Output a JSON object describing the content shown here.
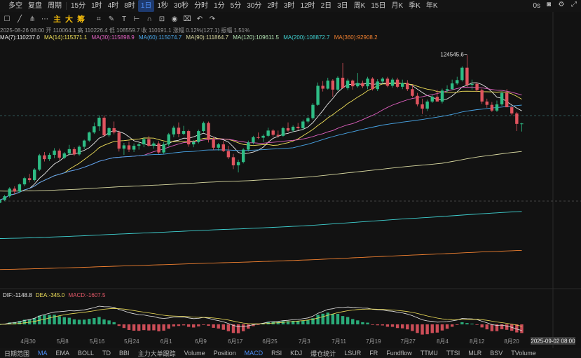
{
  "toolbar": {
    "items": [
      "多空",
      "复盘",
      "周期",
      "15分",
      "1时",
      "4时",
      "8时",
      "1日",
      "1秒",
      "30秒",
      "分时",
      "1分",
      "5分",
      "30分",
      "2时",
      "3时",
      "12时",
      "2日",
      "3日",
      "周K",
      "15日",
      "月K",
      "季K",
      "年K"
    ],
    "active_index": 7,
    "right": [
      "0s"
    ]
  },
  "toolbar2": {
    "zdc": [
      "主",
      "大",
      "筹"
    ]
  },
  "info1": "2025-08-26 08:00  开 110064.1  高 110226.4  低 108559.7  收 110191.1  涨幅 0.12%(127.1)  振幅 1.51%",
  "info2": [
    {
      "text": "MA(7):110237.0",
      "color": "#e8e8e8"
    },
    {
      "text": "MA(14):115371.1",
      "color": "#f0e05a"
    },
    {
      "text": "MA(30):115898.9",
      "color": "#e060c0"
    },
    {
      "text": "MA(60):115074.7",
      "color": "#49a6e8"
    },
    {
      "text": "MA(90):111864.7",
      "color": "#d8d8a0"
    },
    {
      "text": "MA(120):109611.5",
      "color": "#b0e0b0"
    },
    {
      "text": "MA(200):108872.7",
      "color": "#3fd0d0"
    },
    {
      "text": "MA(360):92908.2",
      "color": "#f08030"
    }
  ],
  "macd_legend": [
    {
      "text": "DIF:-1148.8",
      "color": "#e8e8e8"
    },
    {
      "text": "DEA:-345.0",
      "color": "#f0e05a"
    },
    {
      "text": "MACD:-1607.5",
      "color": "#e85a6a"
    }
  ],
  "high_label": "124545.6",
  "crosshair_date": "2025-09-02 08:00",
  "colors": {
    "up": "#2ebd85",
    "down": "#e0545f",
    "bg": "#121212"
  },
  "chart_data": {
    "type": "candlestick",
    "x_ticks": [
      "4月30",
      "5月8",
      "5月16",
      "5月24",
      "6月1",
      "6月9",
      "6月17",
      "6月25",
      "7月3",
      "7月11",
      "7月19",
      "7月27",
      "8月4",
      "8月12",
      "8月20"
    ],
    "candles": [
      [
        93500,
        94300,
        92900,
        94100
      ],
      [
        94100,
        95200,
        93900,
        94900
      ],
      [
        94900,
        96800,
        94600,
        96500
      ],
      [
        96500,
        97000,
        95300,
        95900
      ],
      [
        95900,
        97600,
        95600,
        97400
      ],
      [
        97400,
        99000,
        97000,
        98700
      ],
      [
        98700,
        99600,
        97800,
        98300
      ],
      [
        98300,
        100800,
        98000,
        100500
      ],
      [
        100500,
        103800,
        100200,
        103500
      ],
      [
        103500,
        104200,
        102200,
        102700
      ],
      [
        102700,
        104000,
        102300,
        103600
      ],
      [
        103600,
        105000,
        102900,
        104500
      ],
      [
        104500,
        104900,
        102600,
        103000
      ],
      [
        103000,
        104200,
        102700,
        103900
      ],
      [
        103900,
        105700,
        103500,
        104800
      ],
      [
        104800,
        105200,
        103400,
        103700
      ],
      [
        103700,
        105600,
        103400,
        105300
      ],
      [
        105300,
        106800,
        104800,
        106600
      ],
      [
        106600,
        108500,
        106300,
        108300
      ],
      [
        108300,
        110400,
        108000,
        109600
      ],
      [
        109600,
        111900,
        108600,
        111400
      ],
      [
        111400,
        111900,
        107400,
        107700
      ],
      [
        107700,
        109500,
        107300,
        109200
      ],
      [
        109200,
        110600,
        107900,
        108300
      ],
      [
        108300,
        108700,
        104300,
        104900
      ],
      [
        104900,
        106100,
        103600,
        105600
      ],
      [
        105600,
        106400,
        104200,
        104700
      ],
      [
        104700,
        106000,
        104200,
        105500
      ],
      [
        105500,
        106200,
        104700,
        105800
      ],
      [
        105800,
        107300,
        105200,
        106900
      ],
      [
        106900,
        107600,
        105300,
        105500
      ],
      [
        105500,
        106400,
        104900,
        106000
      ],
      [
        106000,
        106500,
        103800,
        104100
      ],
      [
        104100,
        106300,
        103800,
        105800
      ],
      [
        105800,
        108200,
        105400,
        107900
      ],
      [
        107900,
        109700,
        107300,
        109300
      ],
      [
        109300,
        110400,
        107300,
        108000
      ],
      [
        108000,
        109700,
        107700,
        108600
      ],
      [
        108600,
        108900,
        105300,
        105800
      ],
      [
        105800,
        106700,
        105200,
        106300
      ],
      [
        106300,
        108900,
        106000,
        108600
      ],
      [
        108600,
        110600,
        108300,
        110300
      ],
      [
        110300,
        110600,
        106200,
        106800
      ],
      [
        106800,
        107400,
        104600,
        105100
      ],
      [
        105100,
        106100,
        104500,
        105800
      ],
      [
        105800,
        106500,
        104200,
        104400
      ],
      [
        104400,
        105500,
        102700,
        103100
      ],
      [
        103100,
        103800,
        100600,
        101400
      ],
      [
        101400,
        102600,
        99900,
        102100
      ],
      [
        102100,
        105000,
        101800,
        104700
      ],
      [
        104700,
        106600,
        104300,
        106200
      ],
      [
        106200,
        107600,
        105800,
        107300
      ],
      [
        107300,
        108300,
        106900,
        107200
      ],
      [
        107200,
        107900,
        106300,
        107600
      ],
      [
        107600,
        109300,
        107300,
        108700
      ],
      [
        108700,
        109000,
        107400,
        107800
      ],
      [
        107800,
        108700,
        107200,
        107600
      ],
      [
        107600,
        109500,
        107400,
        109200
      ],
      [
        109200,
        110400,
        108400,
        108700
      ],
      [
        108700,
        109800,
        108400,
        109500
      ],
      [
        109500,
        110300,
        108800,
        109200
      ],
      [
        109200,
        111000,
        108800,
        110600
      ],
      [
        110600,
        111600,
        110200,
        111300
      ],
      [
        111300,
        114500,
        111000,
        114100
      ],
      [
        114100,
        118800,
        113900,
        118100
      ],
      [
        118100,
        119100,
        116900,
        117500
      ],
      [
        117500,
        119800,
        117300,
        119200
      ],
      [
        119200,
        119500,
        115800,
        117300
      ],
      [
        117300,
        120100,
        117000,
        119800
      ],
      [
        119800,
        122900,
        119100,
        117600
      ],
      [
        117600,
        119600,
        117200,
        119200
      ],
      [
        119200,
        119400,
        117300,
        118000
      ],
      [
        118000,
        120800,
        117700,
        118700
      ],
      [
        118700,
        119200,
        117600,
        118000
      ],
      [
        118000,
        120000,
        117400,
        119600
      ],
      [
        119600,
        119900,
        117100,
        117400
      ],
      [
        117400,
        119500,
        117000,
        119000
      ],
      [
        119000,
        119900,
        118500,
        119600
      ],
      [
        119600,
        120000,
        117800,
        118100
      ],
      [
        118100,
        119800,
        117700,
        119400
      ],
      [
        119400,
        119800,
        117600,
        117900
      ],
      [
        117900,
        119400,
        117400,
        118700
      ],
      [
        118700,
        119300,
        117000,
        117400
      ],
      [
        117400,
        118300,
        115700,
        116000
      ],
      [
        116000,
        116600,
        113800,
        114200
      ],
      [
        114200,
        115400,
        112200,
        113300
      ],
      [
        113300,
        115200,
        112800,
        114800
      ],
      [
        114800,
        116200,
        114500,
        115800
      ],
      [
        115800,
        117300,
        115400,
        114800
      ],
      [
        114800,
        117500,
        114400,
        117100
      ],
      [
        117100,
        118200,
        116700,
        117400
      ],
      [
        117400,
        119400,
        117200,
        118600
      ],
      [
        118600,
        120000,
        118300,
        119300
      ],
      [
        119300,
        122200,
        119000,
        121900
      ],
      [
        121900,
        124545.6,
        117800,
        118300
      ],
      [
        118300,
        119400,
        117300,
        118500
      ],
      [
        118500,
        118800,
        116800,
        117200
      ],
      [
        117200,
        117500,
        114300,
        114800
      ],
      [
        114800,
        115400,
        113500,
        114100
      ],
      [
        114100,
        114700,
        112600,
        112900
      ],
      [
        112900,
        115000,
        112600,
        114200
      ],
      [
        114200,
        116900,
        113900,
        116600
      ],
      [
        116600,
        117400,
        113800,
        113600
      ],
      [
        113600,
        113900,
        111900,
        112300
      ],
      [
        112300,
        112600,
        108600,
        110100
      ],
      [
        110100,
        110300,
        108500,
        110191
      ]
    ],
    "ylim": [
      78000,
      127000
    ]
  }
}
